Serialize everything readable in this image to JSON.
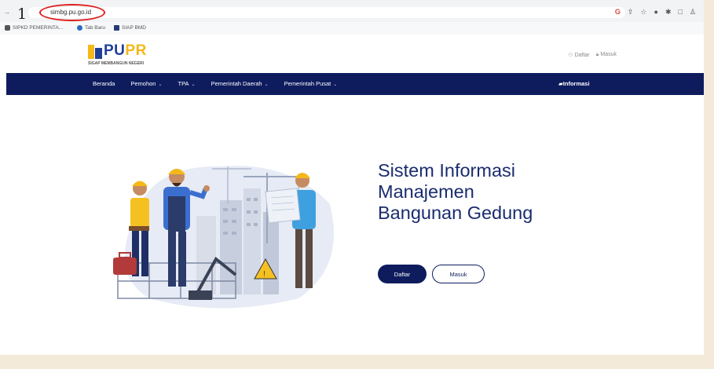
{
  "browser": {
    "step_number": "1",
    "url": "simbg.pu.go.id",
    "back_glyph": "→",
    "refresh_glyph": "C",
    "icons": [
      "google-icon",
      "share-icon",
      "star-icon",
      "extension-icon",
      "pin-icon",
      "window-icon",
      "profile-icon"
    ],
    "bookmarks": [
      {
        "icon": "site-icon",
        "label": "SIPKD PEMERINTA..."
      },
      {
        "icon": "globe-icon",
        "label": "Tab Baru"
      },
      {
        "icon": "flag-icon",
        "label": "SIAP BMD"
      }
    ]
  },
  "header": {
    "logo_pu": "PU",
    "logo_pr": "PR",
    "logo_tagline": "SIGAP MEMBANGUN NEGERI",
    "register_link": "Daftar",
    "login_link": "Masuk"
  },
  "nav": {
    "items": [
      {
        "label": "Beranda",
        "dropdown": false
      },
      {
        "label": "Pemohon",
        "dropdown": true
      },
      {
        "label": "TPA",
        "dropdown": true
      },
      {
        "label": "Pemerintah Daerah",
        "dropdown": true
      },
      {
        "label": "Pemerintah Pusat",
        "dropdown": true
      }
    ],
    "info_label": "Informasi"
  },
  "hero": {
    "title_lines": [
      "Sistem Informasi",
      "Manajemen",
      "Bangunan Gedung"
    ],
    "primary_button": "Daftar",
    "secondary_button": "Masuk"
  },
  "colors": {
    "navbar": "#0e1c5e",
    "title": "#1a2c6e",
    "logo_blue": "#1f3f99",
    "logo_yellow": "#f5b819",
    "annotation_red": "#e01c1c"
  }
}
